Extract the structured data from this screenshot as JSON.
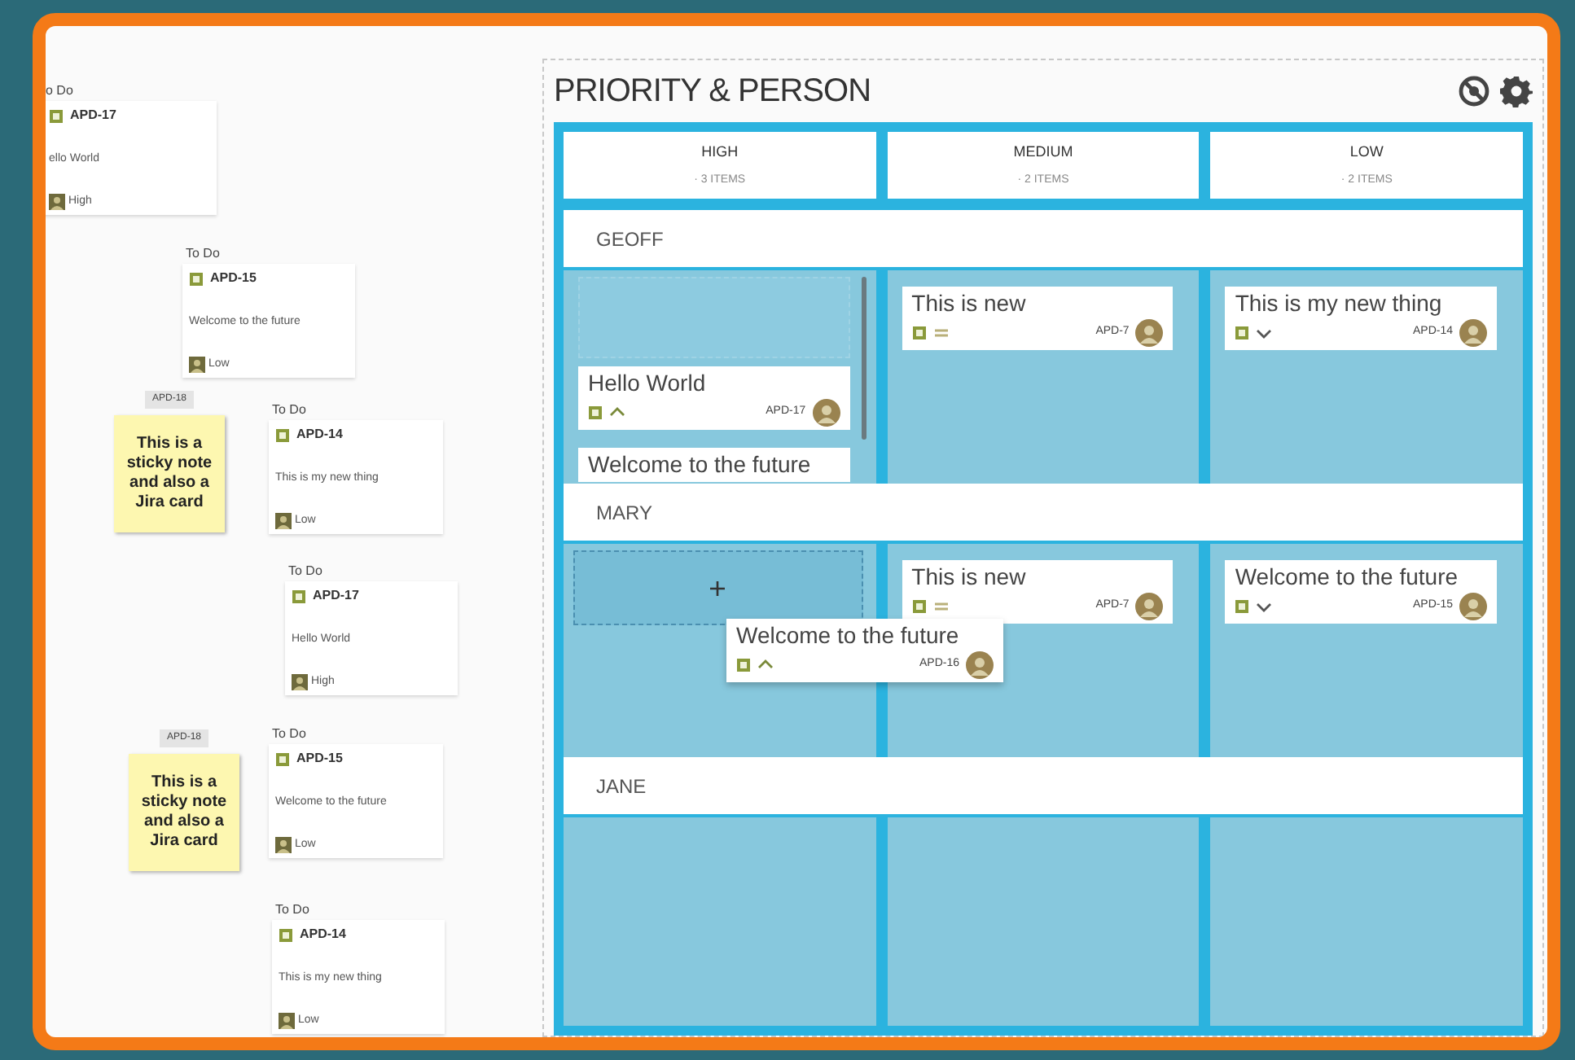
{
  "left_canvas": {
    "issue_cards": [
      {
        "status": "o Do",
        "key": "APD-17",
        "summary": "ello World",
        "priority": "High"
      },
      {
        "status": "To Do",
        "key": "APD-15",
        "summary": "Welcome to the future",
        "priority": "Low"
      },
      {
        "status": "To Do",
        "key": "APD-14",
        "summary": "This is my new thing",
        "priority": "Low"
      },
      {
        "status": "To Do",
        "key": "APD-17",
        "summary": "Hello World",
        "priority": "High"
      },
      {
        "status": "To Do",
        "key": "APD-15",
        "summary": "Welcome to the future",
        "priority": "Low"
      },
      {
        "status": "To Do",
        "key": "APD-14",
        "summary": "This is my new thing",
        "priority": "Low"
      }
    ],
    "sticky_notes": [
      {
        "key": "APD-18",
        "text": "This is a sticky note and also a Jira card"
      },
      {
        "key": "APD-18",
        "text": "This is a sticky note and also a Jira card"
      }
    ]
  },
  "board": {
    "title": "PRIORITY & PERSON",
    "columns": [
      {
        "name": "HIGH",
        "count": "· 3 ITEMS"
      },
      {
        "name": "MEDIUM",
        "count": "· 2 ITEMS"
      },
      {
        "name": "LOW",
        "count": "· 2 ITEMS"
      }
    ],
    "lanes": [
      {
        "name": "GEOFF",
        "cells": [
          {
            "kind": "ghost",
            "scrollbar": true,
            "cards": [
              {
                "summary": "Hello World",
                "kind": "high",
                "key": "APD-17"
              },
              {
                "summary": "Welcome to the future"
              }
            ]
          },
          {
            "cards": [
              {
                "summary": "This is new",
                "kind": "medium",
                "key": "APD-7"
              }
            ]
          },
          {
            "cards": [
              {
                "summary": "This is my new thing",
                "kind": "low",
                "key": "APD-14"
              }
            ]
          }
        ]
      },
      {
        "name": "MARY",
        "cells": [
          {
            "kind": "drop"
          },
          {
            "cards": [
              {
                "summary": "This is new",
                "kind": "medium",
                "key": "APD-7"
              }
            ]
          },
          {
            "cards": [
              {
                "summary": "Welcome to the future",
                "kind": "low",
                "key": "APD-15"
              }
            ]
          }
        ],
        "dragged_card": {
          "summary": "Welcome to the future",
          "kind": "high",
          "key": "APD-16"
        }
      },
      {
        "name": "JANE"
      }
    ]
  }
}
